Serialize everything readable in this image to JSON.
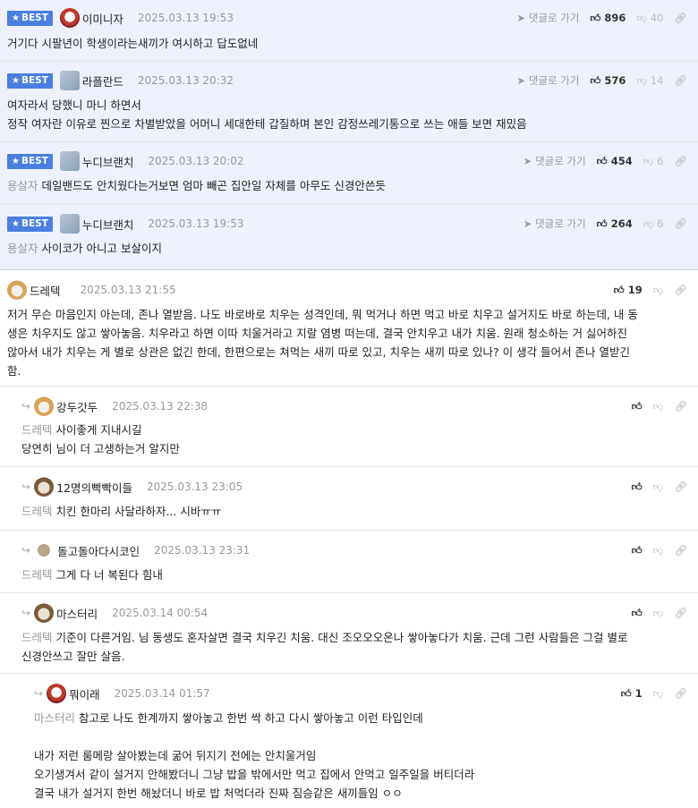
{
  "best_label": "BEST",
  "reply_to_post_label": "댓글로 가기",
  "best_comments": [
    {
      "nick": "이미니자",
      "date": "2025.03.13 19:53",
      "up": "896",
      "down": "40",
      "lines": [
        "거기다 시팔년이 학생이라는새끼가 여시하고 답도없네"
      ]
    },
    {
      "nick": "라플란드",
      "date": "2025.03.13 20:32",
      "up": "576",
      "down": "14",
      "lines": [
        "여자라서 당했니 마니 하면서",
        "정작 여자란 이유로 찐으로 차별받았을 어머니 세대한테 갑질하며 본인 감정쓰레기통으로 쓰는 애들 보면 재밌음"
      ]
    },
    {
      "nick": "누디브랜치",
      "date": "2025.03.13 20:02",
      "up": "454",
      "down": "6",
      "mention": "용살자",
      "lines": [
        "데일밴드도 안치웠다는거보면 엄마 빼곤 집안일 자체를 아무도 신경안쓴듯"
      ]
    },
    {
      "nick": "누디브랜치",
      "date": "2025.03.13 19:53",
      "up": "264",
      "down": "6",
      "mention": "용살자",
      "lines": [
        "사이코가 아니고 보살이지"
      ]
    }
  ],
  "main_comment": {
    "nick": "드레텍",
    "date": "2025.03.13 21:55",
    "up": "19",
    "lines": [
      "저거 무슨 마음인지 아는데, 존나 열받음. 나도 바로바로 치우는 성격인데, 뭐 먹거나 하면 먹고 바로 치우고 설거지도 바로 하는데, 내 동",
      "생은 치우지도 않고 쌓아놓음. 치우라고 하면 이따 치울거라고 지랄 염병 떠는데, 결국 안치우고 내가 치움. 원래 청소하는 거 싫어하진",
      "않아서 내가 치우는 게 별로 상관은 없긴 한데, 한편으로는 쳐먹는 새끼 따로 있고, 치우는 새끼 따로 있나? 이 생각 들어서 존나 열받긴",
      "함."
    ]
  },
  "replies": [
    {
      "nick": "강두갓두",
      "date": "2025.03.13 22:38",
      "up": "",
      "mention": "드레텍",
      "lines": [
        "사이좋게 지내시길",
        "당연히 님이 더 고생하는거 알지만"
      ]
    },
    {
      "nick": "12명의빡빡이들",
      "date": "2025.03.13 23:05",
      "up": "",
      "mention": "드레텍",
      "lines": [
        "치킨 한마리 사달라하자... 시바ㅠㅠ"
      ]
    },
    {
      "nick": "돌고돌아다시코인",
      "date": "2025.03.13 23:31",
      "up": "",
      "mention": "드레텍",
      "lines": [
        "그게 다 너 복된다 힘내"
      ]
    },
    {
      "nick": "마스터리",
      "date": "2025.03.14 00:54",
      "up": "",
      "mention": "드레텍",
      "lines": [
        "기준이 다른거임. 님 동생도 혼자살면 결국 치우긴 치움. 대신 조오오오온나 쌓아놓다가 치움. 근데 그런 사람들은 그걸 별로",
        "신경안쓰고 잘만 살음."
      ]
    },
    {
      "nick": "뭐이래",
      "date": "2025.03.14 01:57",
      "up": "1",
      "mention": "마스터리",
      "lines": [
        "참고로 나도 한계까지 쌓아놓고 한번 싹 하고 다시 쌓아놓고 이런 타입인데",
        "",
        "내가 저런 룸메랑 살아봤는데 굶어 뒤지기 전에는 안치울거임",
        "오기생겨서 같이 설거지 안해봤더니 그냥 밥을 밖에서만 먹고 집에서 안먹고 일주일을 버티더라",
        "결국 내가 설거지 한번 해놨더니 바로 밥 처먹더라 진짜 짐승같은 새끼들임 ㅇㅇ"
      ]
    }
  ]
}
